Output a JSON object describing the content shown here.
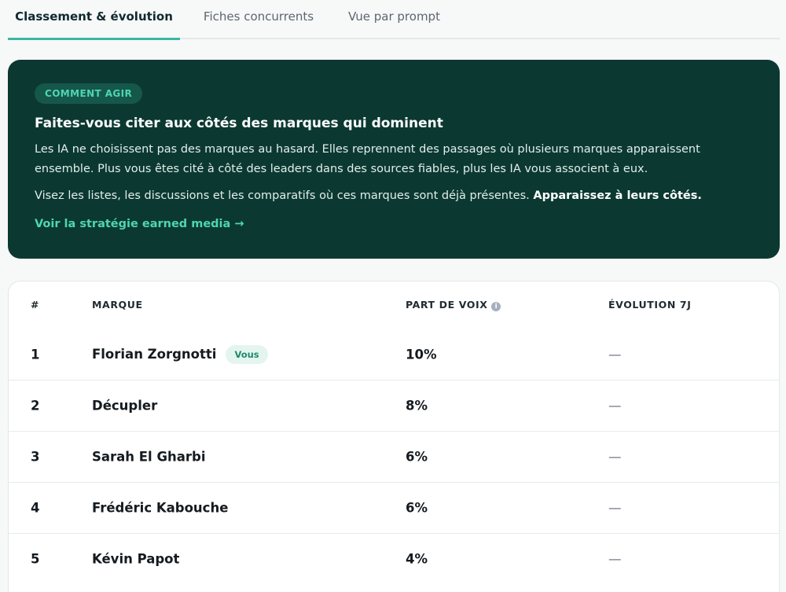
{
  "tabs": [
    {
      "label": "Classement & évolution",
      "active": true
    },
    {
      "label": "Fiches concurrents",
      "active": false
    },
    {
      "label": "Vue par prompt",
      "active": false
    }
  ],
  "action_card": {
    "badge": "COMMENT AGIR",
    "title": "Faites-vous citer aux côtés des marques qui dominent",
    "paragraph1": "Les IA ne choisissent pas des marques au hasard. Elles reprennent des passages où plusieurs marques apparaissent ensemble. Plus vous êtes cité à côté des leaders dans des sources fiables, plus les IA vous associent à eux.",
    "paragraph2": "Visez les listes, les discussions et les comparatifs où ces marques sont déjà présentes.",
    "paragraph2_strong": "Apparaissez à leurs côtés.",
    "link": "Voir la stratégie earned media →"
  },
  "table": {
    "headers": {
      "rank": "#",
      "brand": "MARQUE",
      "share": "PART DE VOIX",
      "evolution": "ÉVOLUTION 7J"
    },
    "you_badge": "Vous",
    "rows": [
      {
        "rank": "1",
        "brand": "Florian Zorgnotti",
        "share": "10%",
        "evolution": "—",
        "is_you": true
      },
      {
        "rank": "2",
        "brand": "Décupler",
        "share": "8%",
        "evolution": "—",
        "is_you": false
      },
      {
        "rank": "3",
        "brand": "Sarah El Gharbi",
        "share": "6%",
        "evolution": "—",
        "is_you": false
      },
      {
        "rank": "4",
        "brand": "Frédéric Kabouche",
        "share": "6%",
        "evolution": "—",
        "is_you": false
      },
      {
        "rank": "5",
        "brand": "Kévin Papot",
        "share": "4%",
        "evolution": "—",
        "is_you": false
      }
    ]
  },
  "colors": {
    "accent": "#3ab7a3",
    "card_bg": "#0b3932",
    "badge_text": "#4fd5b3"
  }
}
